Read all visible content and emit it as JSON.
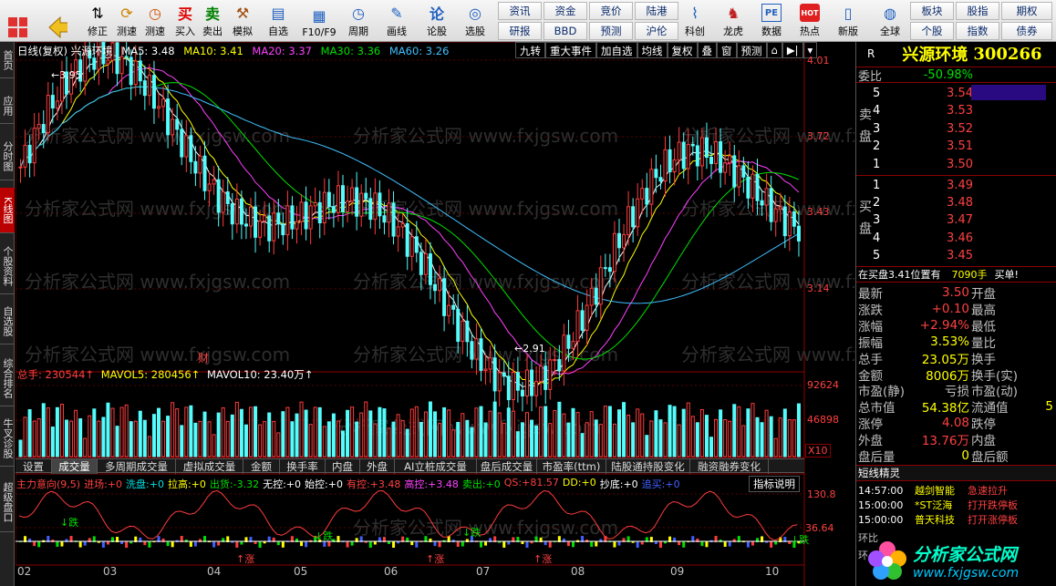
{
  "toolbar": {
    "buttons": [
      {
        "name": "mosaic",
        "label": "",
        "icon": "grid-icon"
      },
      {
        "name": "back",
        "label": "",
        "icon": "back-arrow-icon"
      },
      {
        "name": "xiuzheng",
        "label": "修正",
        "icon": "up-down-arrow-icon"
      },
      {
        "name": "ceshu",
        "label": "测速",
        "icon": "refresh-icon"
      },
      {
        "name": "mai-ru",
        "label": "买入",
        "icon": "buy-icon",
        "text": "买"
      },
      {
        "name": "mai-chu",
        "label": "卖出",
        "icon": "sell-icon",
        "text": "卖"
      },
      {
        "name": "moni",
        "label": "模拟",
        "icon": "hammer-icon"
      },
      {
        "name": "zixuan",
        "label": "自选",
        "icon": "folder-star-icon"
      },
      {
        "name": "f10",
        "label": "F10/F9",
        "icon": "document-icon"
      },
      {
        "name": "zhouqi",
        "label": "周期",
        "icon": "clock-icon"
      },
      {
        "name": "huaxian",
        "label": "画线",
        "icon": "pencil-icon"
      },
      {
        "name": "lunzheng",
        "label": "论股",
        "icon": "forum-icon",
        "text": "论"
      },
      {
        "name": "xuangu",
        "label": "选股",
        "icon": "chart-search-icon"
      },
      {
        "name": "yanbao",
        "label": "研报",
        "top": "资讯"
      },
      {
        "name": "bbd",
        "label": "BBD",
        "top": "资金"
      },
      {
        "name": "yuce",
        "label": "预测",
        "top": "竞价"
      },
      {
        "name": "hulun",
        "label": "沪伦",
        "top": "陆港"
      },
      {
        "name": "kechuang",
        "label": "科创",
        "icon": "line-chart-icon"
      },
      {
        "name": "longhu",
        "label": "龙虎",
        "icon": "dragon-icon"
      },
      {
        "name": "shuju",
        "label": "数据",
        "icon": "pe-icon",
        "text": "PE"
      },
      {
        "name": "redian",
        "label": "热点",
        "icon": "hot-icon",
        "text": "HOT"
      },
      {
        "name": "xinban",
        "label": "新版",
        "icon": "phone-icon"
      },
      {
        "name": "quanqiu",
        "label": "全球",
        "icon": "globe-icon"
      },
      {
        "name": "bankuai",
        "label": "个股",
        "top": "板块"
      },
      {
        "name": "gubao",
        "label": "指数",
        "top": "股指"
      },
      {
        "name": "qihuo",
        "label": "债券",
        "top": "期权"
      }
    ]
  },
  "leftnav": [
    "首页",
    "应用",
    "分时图",
    "K线图",
    "个股资料",
    "自选股",
    "综合排名",
    "牛叉诊股",
    "超级盘口"
  ],
  "chart_header": {
    "title": "日线(复权)  兴源环境",
    "ma5": "MA5: 3.48",
    "ma10": "MA10: 3.41",
    "ma20": "MA20: 3.37",
    "ma30": "MA30: 3.36",
    "ma60": "MA60: 3.26",
    "menu": [
      "九转",
      "重大事件",
      "加自选",
      "均线",
      "复权",
      "叠",
      "窗",
      "预测"
    ]
  },
  "price_axis": [
    "4.01",
    "3.72",
    "3.43",
    "3.14"
  ],
  "price_marks": {
    "high": "3.95",
    "low": "2.91",
    "event": "财"
  },
  "volume_header": {
    "label": "总手: 230544↑",
    "mavol5": "MAVOL5: 280456↑",
    "mavol10": "MAVOL10: 23.40万↑"
  },
  "volume_axis": [
    "92624",
    "46898",
    "X10"
  ],
  "bottom_tabs": [
    "设置",
    "成交量",
    "多周期成交量",
    "虚拟成交量",
    "金额",
    "换手率",
    "内盘",
    "外盘",
    "AI立桩成交量",
    "盘后成交量",
    "市盈率(ttm)",
    "陆股通持股变化",
    "融资融券变化"
  ],
  "indicator": {
    "name": "主力意向(9,5)",
    "items": [
      {
        "k": "进场:",
        "v": "+0"
      },
      {
        "k": "洗盘:",
        "v": "+0"
      },
      {
        "k": "拉高:",
        "v": "+0"
      },
      {
        "k": "出货:",
        "v": "-3.32"
      },
      {
        "k": "无控:",
        "v": "+0"
      },
      {
        "k": "始控:",
        "v": "+0"
      },
      {
        "k": "有控:",
        "v": "+3.48"
      },
      {
        "k": "高控:",
        "v": "+3.48"
      },
      {
        "k": "卖出:",
        "v": "+0"
      },
      {
        "k": "QS:",
        "v": "+81.57"
      },
      {
        "k": "DD:",
        "v": "+0"
      },
      {
        "k": "抄底:",
        "v": "+0"
      },
      {
        "k": "追买:",
        "v": "+0"
      }
    ],
    "help": "指标说明",
    "axis": [
      "130.8",
      "36.64"
    ],
    "marks": {
      "down": "↓跌",
      "up": "↑涨"
    }
  },
  "dates": [
    "02",
    "03",
    "04",
    "05",
    "06",
    "07",
    "08",
    "09",
    "10"
  ],
  "watermark": "分析家公式网 www.fxjgsw.com",
  "right": {
    "r_label": "R",
    "name": "兴源环境",
    "code": "300266",
    "weibi_label": "委比",
    "weibi_value": "-50.98%",
    "sell_label": "卖盘",
    "buy_label": "买盘",
    "sells": [
      {
        "lvl": "5",
        "price": "3.54"
      },
      {
        "lvl": "4",
        "price": "3.53"
      },
      {
        "lvl": "3",
        "price": "3.52"
      },
      {
        "lvl": "2",
        "price": "3.51"
      },
      {
        "lvl": "1",
        "price": "3.50"
      }
    ],
    "buys": [
      {
        "lvl": "1",
        "price": "3.49"
      },
      {
        "lvl": "2",
        "price": "3.48"
      },
      {
        "lvl": "3",
        "price": "3.47"
      },
      {
        "lvl": "4",
        "price": "3.46"
      },
      {
        "lvl": "5",
        "price": "3.45"
      }
    ],
    "notice_left": "在买盘3.41位置有",
    "notice_vol": "7090手",
    "notice_right": "买单!",
    "stats": [
      {
        "k": "最新",
        "v": "3.50",
        "c": "red",
        "k2": "开盘"
      },
      {
        "k": "涨跌",
        "v": "+0.10",
        "c": "red",
        "k2": "最高"
      },
      {
        "k": "涨幅",
        "v": "+2.94%",
        "c": "red",
        "k2": "最低"
      },
      {
        "k": "振幅",
        "v": "3.53%",
        "c": "yel",
        "k2": "量比"
      },
      {
        "k": "总手",
        "v": "23.05万",
        "c": "yel",
        "k2": "换手"
      },
      {
        "k": "金额",
        "v": "8006万",
        "c": "yel",
        "k2": "换手(实)"
      },
      {
        "k": "市盈(静)",
        "v": "亏损",
        "c": "lbl",
        "k2": "市盈(动)"
      },
      {
        "k": "总市值",
        "v": "54.38亿",
        "c": "yel",
        "k2": "流通值"
      },
      {
        "k": "涨停",
        "v": "4.08",
        "c": "red",
        "k2": "跌停"
      },
      {
        "k": "外盘",
        "v": "13.76万",
        "c": "red",
        "k2": "内盘"
      },
      {
        "k": "盘后量",
        "v": "0",
        "c": "yel",
        "k2": "盘后额"
      }
    ],
    "liutong_extra": "5",
    "short_title": "短线精灵",
    "short_rows": [
      {
        "t": "14:57:00",
        "name": "越剑智能",
        "evt": "急速拉升"
      },
      {
        "t": "15:00:00",
        "name": "*ST泛海",
        "evt": "打开跌停板"
      },
      {
        "t": "15:00:00",
        "name": "普天科技",
        "evt": "打开涨停板"
      }
    ],
    "brand": "分析家公式网",
    "brand_url": "www.fxjgsw.com",
    "hist_label": "环",
    "hist_label2": "环比"
  }
}
